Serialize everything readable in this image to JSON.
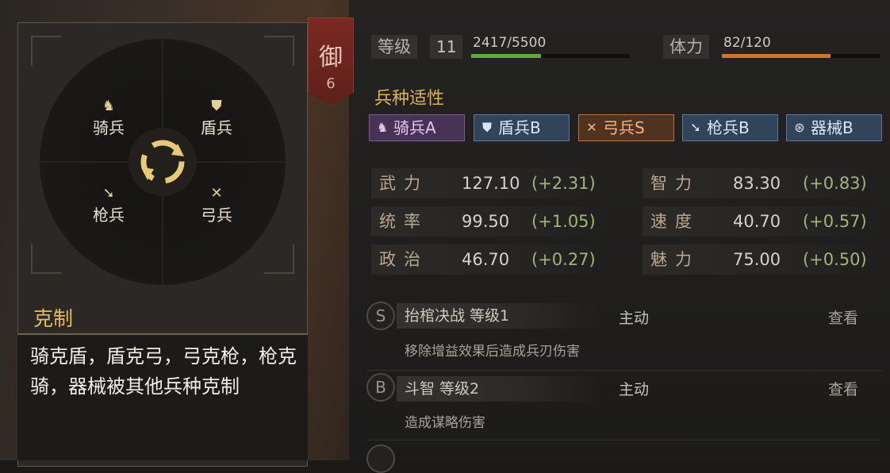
{
  "rank": {
    "char": "御",
    "level": "6"
  },
  "stats": {
    "level_label": "等级",
    "level_value": "11",
    "exp_text": "2417/5500",
    "exp_progress": 0.44,
    "stamina_label": "体力",
    "stamina_text": "82/120",
    "stamina_progress": 0.683,
    "exp_color": "#5fa83a",
    "stamina_color": "#d0742f"
  },
  "suitability": {
    "title": "兵种适性",
    "items": [
      {
        "icon": "horse-icon",
        "glyph": "♞",
        "label": "骑兵A"
      },
      {
        "icon": "shield-icon",
        "glyph": "⛊",
        "label": "盾兵B"
      },
      {
        "icon": "bow-icon",
        "glyph": "✕",
        "label": "弓兵S"
      },
      {
        "icon": "spear-icon",
        "glyph": "➘",
        "label": "枪兵B"
      },
      {
        "icon": "machine-icon",
        "glyph": "⊛",
        "label": "器械B"
      }
    ]
  },
  "attributes": [
    {
      "name": "武力",
      "value": "127.10",
      "bonus": "(+2.31)"
    },
    {
      "name": "智力",
      "value": "83.30",
      "bonus": "(+0.83)"
    },
    {
      "name": "统率",
      "value": "99.50",
      "bonus": "(+1.05)"
    },
    {
      "name": "速度",
      "value": "40.70",
      "bonus": "(+0.57)"
    },
    {
      "name": "政治",
      "value": "46.70",
      "bonus": "(+0.27)"
    },
    {
      "name": "魅力",
      "value": "75.00",
      "bonus": "(+0.50)"
    }
  ],
  "skills": [
    {
      "grade": "S",
      "name": "抬棺决战 等级1",
      "type": "主动",
      "view": "查看",
      "desc": "移除增益效果后造成兵刃伤害"
    },
    {
      "grade": "B",
      "name": "斗智 等级2",
      "type": "主动",
      "view": "查看",
      "desc": "造成谋略伤害"
    }
  ],
  "counter_panel": {
    "units": {
      "cavalry": "骑兵",
      "shield": "盾兵",
      "spear": "枪兵",
      "archer": "弓兵"
    },
    "title": "克制",
    "text": "骑克盾，盾克弓，弓克枪，枪克骑，器械被其他兵种克制"
  }
}
